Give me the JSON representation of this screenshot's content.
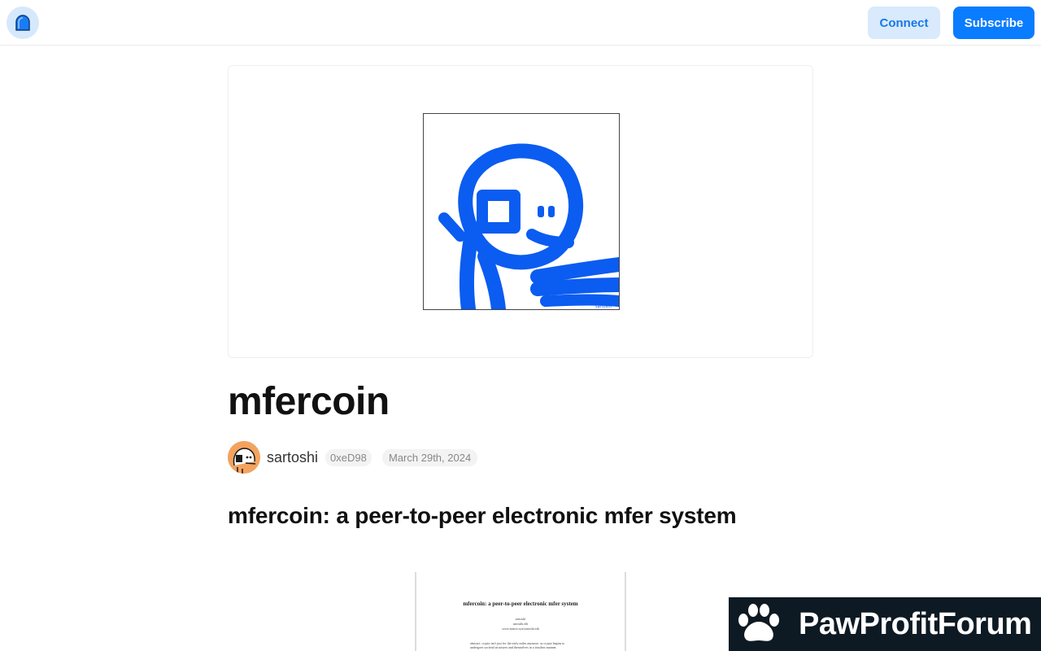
{
  "header": {
    "logo_icon": "paragraph-arch-logo-icon",
    "connect_label": "Connect",
    "subscribe_label": "Subscribe",
    "accent_color": "#0a7cff"
  },
  "post": {
    "cover_icon": "mfer-drawing-icon",
    "title": "mfercoin",
    "author": {
      "name": "sartoshi",
      "address": "0xeD98",
      "avatar_icon": "mfer-avatar-icon"
    },
    "date": "March 29th, 2024",
    "subtitle": "mfercoin: a peer-to-peer electronic mfer system",
    "embedded_paper": {
      "title": "mfercoin: a peer-to-peer electronic mfer system",
      "author": "sartoshi",
      "affiliation": "sartoshi.eth",
      "url": "www.mirror.xyz/sartoshi.eth",
      "abstract": "abstract. crypto isn't just for the early miles anymore. as crypto begins to undergoes societal structures and themselves in a trustless manner,"
    }
  },
  "watermark": {
    "icon": "paw-icon",
    "text": "PawProfitForum"
  }
}
